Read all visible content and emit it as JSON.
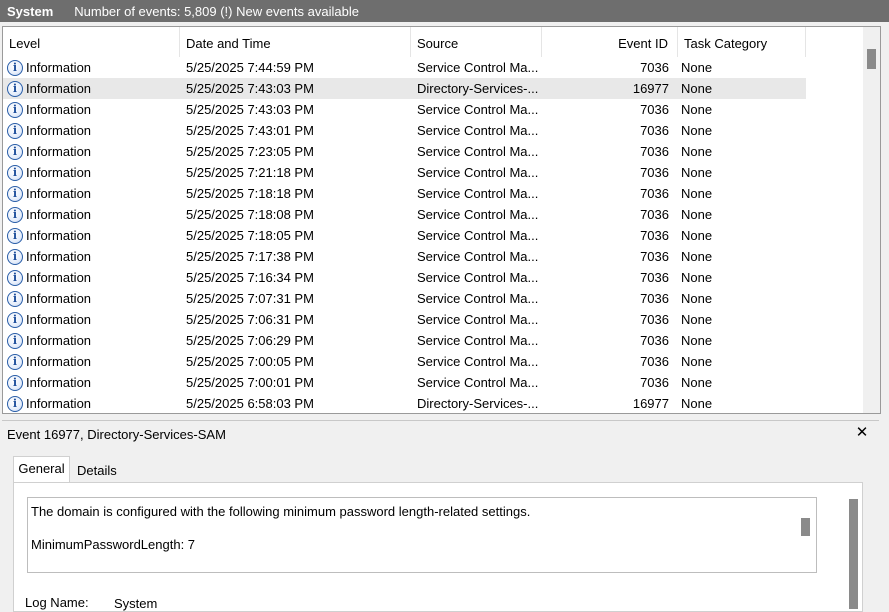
{
  "titlebar": {
    "name": "System",
    "count": "Number of events: 5,809 (!) New events available"
  },
  "columns": {
    "level": "Level",
    "date": "Date and Time",
    "source": "Source",
    "event_id": "Event ID",
    "task": "Task Category"
  },
  "rows": [
    {
      "level": "Information",
      "date": "5/25/2025 7:44:59 PM",
      "source": "Service Control Ma...",
      "id": "7036",
      "cat": "None"
    },
    {
      "level": "Information",
      "date": "5/25/2025 7:43:03 PM",
      "source": "Directory-Services-...",
      "id": "16977",
      "cat": "None"
    },
    {
      "level": "Information",
      "date": "5/25/2025 7:43:03 PM",
      "source": "Service Control Ma...",
      "id": "7036",
      "cat": "None"
    },
    {
      "level": "Information",
      "date": "5/25/2025 7:43:01 PM",
      "source": "Service Control Ma...",
      "id": "7036",
      "cat": "None"
    },
    {
      "level": "Information",
      "date": "5/25/2025 7:23:05 PM",
      "source": "Service Control Ma...",
      "id": "7036",
      "cat": "None"
    },
    {
      "level": "Information",
      "date": "5/25/2025 7:21:18 PM",
      "source": "Service Control Ma...",
      "id": "7036",
      "cat": "None"
    },
    {
      "level": "Information",
      "date": "5/25/2025 7:18:18 PM",
      "source": "Service Control Ma...",
      "id": "7036",
      "cat": "None"
    },
    {
      "level": "Information",
      "date": "5/25/2025 7:18:08 PM",
      "source": "Service Control Ma...",
      "id": "7036",
      "cat": "None"
    },
    {
      "level": "Information",
      "date": "5/25/2025 7:18:05 PM",
      "source": "Service Control Ma...",
      "id": "7036",
      "cat": "None"
    },
    {
      "level": "Information",
      "date": "5/25/2025 7:17:38 PM",
      "source": "Service Control Ma...",
      "id": "7036",
      "cat": "None"
    },
    {
      "level": "Information",
      "date": "5/25/2025 7:16:34 PM",
      "source": "Service Control Ma...",
      "id": "7036",
      "cat": "None"
    },
    {
      "level": "Information",
      "date": "5/25/2025 7:07:31 PM",
      "source": "Service Control Ma...",
      "id": "7036",
      "cat": "None"
    },
    {
      "level": "Information",
      "date": "5/25/2025 7:06:31 PM",
      "source": "Service Control Ma...",
      "id": "7036",
      "cat": "None"
    },
    {
      "level": "Information",
      "date": "5/25/2025 7:06:29 PM",
      "source": "Service Control Ma...",
      "id": "7036",
      "cat": "None"
    },
    {
      "level": "Information",
      "date": "5/25/2025 7:00:05 PM",
      "source": "Service Control Ma...",
      "id": "7036",
      "cat": "None"
    },
    {
      "level": "Information",
      "date": "5/25/2025 7:00:01 PM",
      "source": "Service Control Ma...",
      "id": "7036",
      "cat": "None"
    },
    {
      "level": "Information",
      "date": "5/25/2025 6:58:03 PM",
      "source": "Directory-Services-...",
      "id": "16977",
      "cat": "None"
    }
  ],
  "selected_row": 1,
  "level_icon": "information-icon",
  "detail": {
    "title": "Event 16977, Directory-Services-SAM",
    "close_icon": "close-icon",
    "close_glyph": "✕",
    "tabs": [
      "General",
      "Details"
    ],
    "message_line1": "The domain is configured with the following minimum password length-related settings.",
    "message_line2": "MinimumPasswordLength: 7",
    "log_name_label": "Log Name:",
    "log_name_value": "System"
  },
  "colors": {
    "titlebar_bg": "#6e6e6e",
    "selected_row_bg": "#e8e8e8",
    "info_icon_blue": "#2a5ea8"
  }
}
